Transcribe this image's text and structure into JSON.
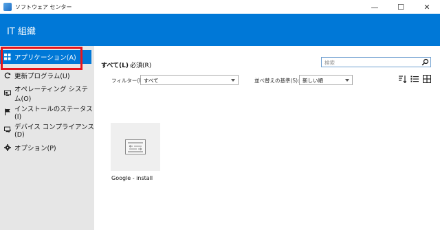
{
  "window": {
    "title": "ソフトウェア センター",
    "minimize_glyph": "—",
    "maximize_glyph": "☐",
    "close_glyph": "✕"
  },
  "header": {
    "title": "IT 組織"
  },
  "sidebar": {
    "items": [
      {
        "label": "アプリケーション(A)",
        "icon": "grid-apps-icon",
        "active": true
      },
      {
        "label": "更新プログラム(U)",
        "icon": "refresh-icon",
        "active": false
      },
      {
        "label": "オペレーティング システム(O)",
        "icon": "monitor-os-icon",
        "active": false
      },
      {
        "label": "インストールのステータス(I)",
        "icon": "flag-icon",
        "active": false
      },
      {
        "label": "デバイス コンプライアンス(D)",
        "icon": "device-compliance-icon",
        "active": false
      },
      {
        "label": "オプション(P)",
        "icon": "gear-icon",
        "active": false
      }
    ]
  },
  "main": {
    "tabs": [
      {
        "label": "すべて(L)",
        "active": true
      },
      {
        "label": "必須(R)",
        "active": false
      }
    ],
    "search": {
      "placeholder": "検索"
    },
    "filter": {
      "label": "フィルター(F):",
      "value": "すべて"
    },
    "sort": {
      "label": "並べ替えの基準(S):",
      "value": "新しい順"
    },
    "apps": [
      {
        "name": "Google - install",
        "icon": "app-package-icon"
      }
    ]
  },
  "colors": {
    "accent": "#0078d7",
    "sidebar_bg": "#e6e6e6",
    "highlight": "#e8141b"
  }
}
